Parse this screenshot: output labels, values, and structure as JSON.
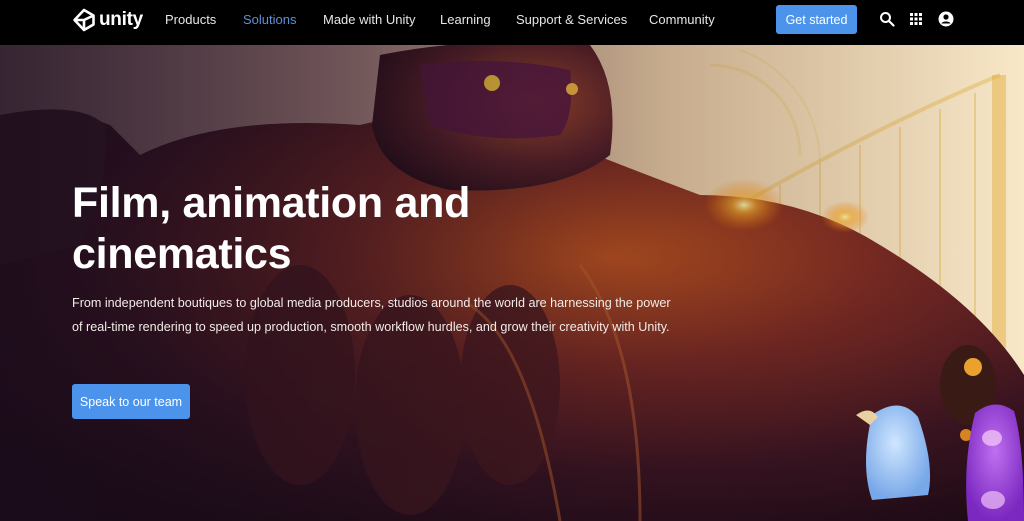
{
  "brand": {
    "name": "unity",
    "logo_icon": "unity-cube-icon"
  },
  "nav": {
    "items": [
      {
        "label": "Products",
        "active": false
      },
      {
        "label": "Solutions",
        "active": true
      },
      {
        "label": "Made with Unity",
        "active": false
      },
      {
        "label": "Learning",
        "active": false
      },
      {
        "label": "Support & Services",
        "active": false
      },
      {
        "label": "Community",
        "active": false
      }
    ],
    "cta_label": "Get started",
    "icons": [
      "search-icon",
      "apps-grid-icon",
      "account-icon"
    ]
  },
  "hero": {
    "title_line1": "Film, animation and",
    "title_line2": "cinematics",
    "description": "From independent boutiques to global media producers, studios around the world are harnessing the power of real-time rendering to speed up production, smooth workflow hurdles, and grow their creativity with Unity.",
    "button_label": "Speak to our team"
  },
  "colors": {
    "accent": "#4c94eb",
    "nav_active": "#5f8fd8",
    "nav_bg": "#000000"
  }
}
